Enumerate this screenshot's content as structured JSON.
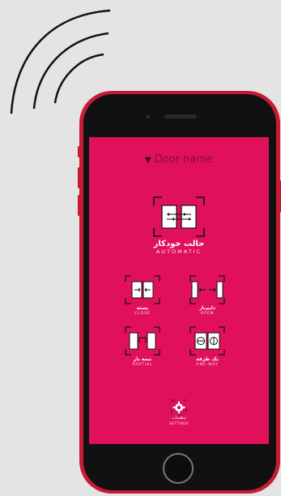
{
  "app": {
    "door_name": "Door name",
    "colors": {
      "screen_bg": "#e0105a",
      "phone_frame": "#c81a35",
      "phone_body": "#111111"
    }
  },
  "modes": {
    "automatic": {
      "fa": "حالت خودکار",
      "en": "AUTOMATIC",
      "icon": "sliding-doors-bidirectional-icon"
    },
    "close": {
      "fa": "بسته",
      "en": "CLOSE",
      "icon": "doors-closed-icon"
    },
    "open": {
      "fa": "دایم‌باز",
      "en": "OPEN",
      "icon": "doors-open-icon"
    },
    "partial": {
      "fa": "نیمه باز",
      "en": "PARTIAL",
      "icon": "doors-partial-icon"
    },
    "oneway": {
      "fa": "یک طرفه",
      "en": "ONE-WAY",
      "icon": "one-way-icon"
    }
  },
  "settings": {
    "fa": "تنظیمات",
    "en": "SETTINGS",
    "icon": "gear-icon"
  }
}
